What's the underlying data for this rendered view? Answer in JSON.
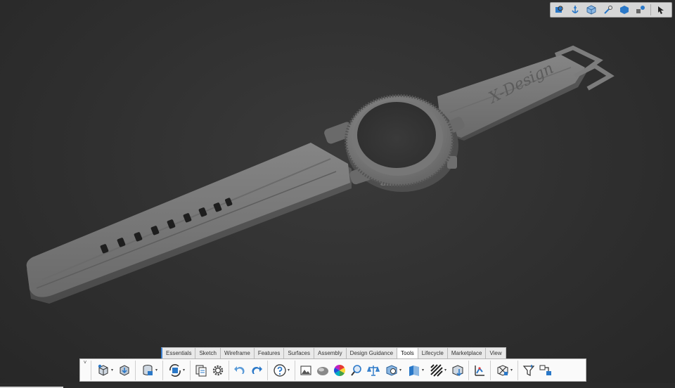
{
  "model": {
    "brand_text": "X-Design"
  },
  "view_toolbar": {
    "buttons": [
      {
        "icon": "zoom-to-fit-icon"
      },
      {
        "icon": "anchor-icon"
      },
      {
        "icon": "cube-view-icon"
      },
      {
        "icon": "section-view-icon"
      },
      {
        "icon": "display-style-icon"
      },
      {
        "icon": "hide-show-icon"
      },
      {
        "icon": "pointer-icon"
      }
    ]
  },
  "tabs": [
    {
      "label": "Essentials",
      "active": false
    },
    {
      "label": "Sketch",
      "active": false
    },
    {
      "label": "Wireframe",
      "active": false
    },
    {
      "label": "Features",
      "active": false
    },
    {
      "label": "Surfaces",
      "active": false
    },
    {
      "label": "Assembly",
      "active": false
    },
    {
      "label": "Design Guidance",
      "active": false
    },
    {
      "label": "Tools",
      "active": true
    },
    {
      "label": "Lifecycle",
      "active": false
    },
    {
      "label": "Marketplace",
      "active": false
    },
    {
      "label": "View",
      "active": false
    }
  ],
  "ribbon": {
    "collapse_glyph": "˅",
    "tools": [
      {
        "icon": "part-icon",
        "dropdown": true
      },
      {
        "icon": "save-icon",
        "dropdown": false
      },
      {
        "icon": "database-icon",
        "dropdown": true
      },
      {
        "icon": "rebuild-icon",
        "dropdown": true
      },
      {
        "icon": "copy-icon",
        "dropdown": false
      },
      {
        "icon": "settings-gear-icon",
        "dropdown": false
      },
      {
        "icon": "undo-icon",
        "dropdown": false
      },
      {
        "icon": "redo-icon",
        "dropdown": false
      },
      {
        "icon": "help-icon",
        "dropdown": true
      },
      {
        "icon": "render-image-icon",
        "dropdown": false
      },
      {
        "icon": "appearance-sphere-icon",
        "dropdown": false
      },
      {
        "icon": "color-wheel-icon",
        "dropdown": false
      },
      {
        "icon": "measure-icon",
        "dropdown": false
      },
      {
        "icon": "mass-properties-icon",
        "dropdown": false
      },
      {
        "icon": "section-properties-icon",
        "dropdown": true
      },
      {
        "icon": "check-geometry-icon",
        "dropdown": true
      },
      {
        "icon": "zebra-stripes-icon",
        "dropdown": true
      },
      {
        "icon": "export-icon",
        "dropdown": false
      },
      {
        "icon": "deviation-icon",
        "dropdown": false
      },
      {
        "icon": "draft-analysis-icon",
        "dropdown": true
      },
      {
        "icon": "filter-icon",
        "dropdown": false
      },
      {
        "icon": "compare-icon",
        "dropdown": false
      }
    ]
  },
  "colors": {
    "background": "#2f2f2f",
    "model": "#7a7a7a",
    "accent": "#3a7fd0",
    "icon_blue": "#2a78c8"
  }
}
